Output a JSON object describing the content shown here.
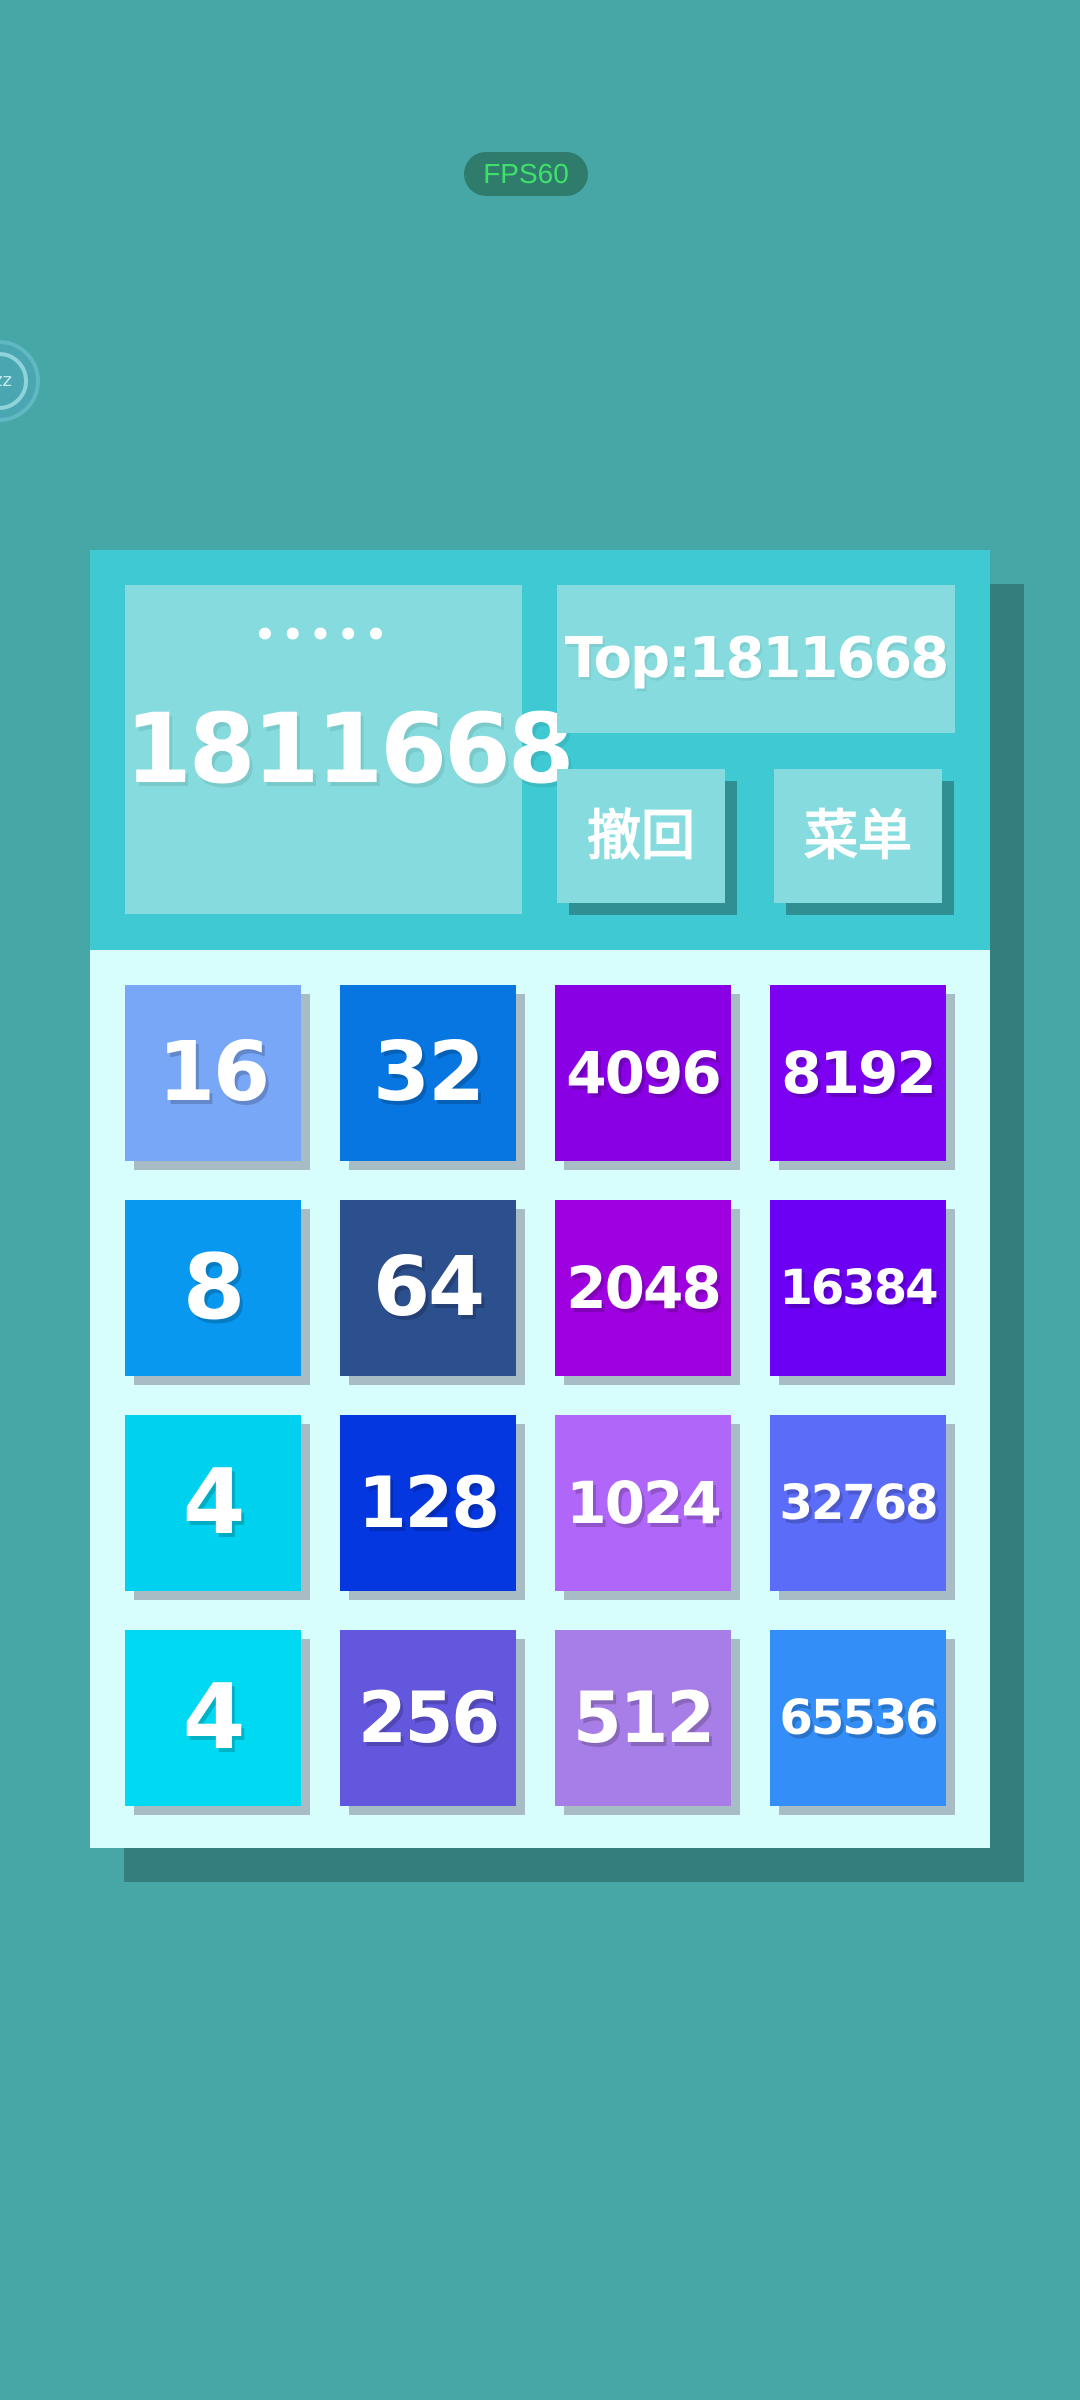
{
  "status_overlay": {
    "fps_label": "FPS60",
    "float_ball_text": "zz"
  },
  "header": {
    "score_dots": "•••••",
    "score": "1811668",
    "top_score": "Top:1811668",
    "undo_label": "撤回",
    "menu_label": "菜单"
  },
  "grid": {
    "rows": [
      [
        {
          "value": "16",
          "color": "#78a7f8"
        },
        {
          "value": "32",
          "color": "#0776e1"
        },
        {
          "value": "4096",
          "color": "#8a00e4"
        },
        {
          "value": "8192",
          "color": "#7c00f2"
        }
      ],
      [
        {
          "value": "8",
          "color": "#0898ef"
        },
        {
          "value": "64",
          "color": "#2c4f8e"
        },
        {
          "value": "2048",
          "color": "#9f00e0"
        },
        {
          "value": "16384",
          "color": "#6b00f4"
        }
      ],
      [
        {
          "value": "4",
          "color": "#00d1ef"
        },
        {
          "value": "128",
          "color": "#0437e0"
        },
        {
          "value": "1024",
          "color": "#b066f9"
        },
        {
          "value": "32768",
          "color": "#5b6cf8"
        }
      ],
      [
        {
          "value": "4",
          "color": "#00d9f2"
        },
        {
          "value": "256",
          "color": "#6357de"
        },
        {
          "value": "512",
          "color": "#a77ee7"
        },
        {
          "value": "65536",
          "color": "#338ef8"
        }
      ]
    ]
  }
}
